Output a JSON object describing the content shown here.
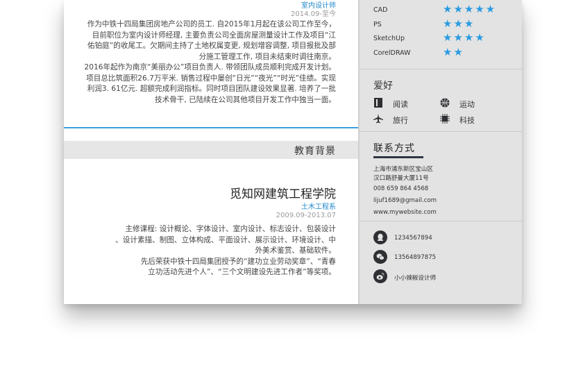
{
  "work": {
    "role": "室内设计师",
    "date": "2014.09-至今",
    "para1": "作为中铁十四局集团房地产公司的员工. 自2015年1月起在该公司工作至今，\n目前职位为室内设计师经理, 主要负责公司全面房屋测量设计工作及项目“江\n佑铂庭”的收尾工。欠期间主持了土地权属变更, 规划增容调整, 项目报批及部\n分施工管理工作, 项目未结束时调往南京。",
    "para2": "2016年起作为南京“美丽办公”项目负责人. 带领团队成员顺利完成开发计划。\n项目总比筑面积26.7万平米. 销售过程中屡创“日光”“夜光”“时光”佳绩。实现\n利润3. 61亿元. 超额完成利润指标。同时项目团队建设效果显著. 培养了一批\n技术骨干, 已陆续在公司其他项目开发工作中独当一面。"
  },
  "education": {
    "section_title": "教育背景",
    "school": "觅知网建筑工程学院",
    "major": "土木工程系",
    "date": "2009.09-2013.07",
    "para": "主修课程: 设计概论、字体设计、室内设计、标志设计、包装设计\n、设计素描、制图、立体构成、平面设计、展示设计、环境设计、中\n外美术鉴赏、基础软件。\n先后荣获中铁十四局集团授予的“建功立业劳动奖章”、“青春\n立功活动先进个人”、“三个文明建设先进工作者”等奖项。"
  },
  "skills": [
    {
      "name": "CAD",
      "stars": "★★★★★"
    },
    {
      "name": "PS",
      "stars": "★★★"
    },
    {
      "name": "SketchUp",
      "stars": "★★★★"
    },
    {
      "name": "CorelDRAW",
      "stars": "★★"
    }
  ],
  "hobbies": {
    "title": "爱好",
    "items": [
      {
        "label": "阅读",
        "icon": "book-icon"
      },
      {
        "label": "运动",
        "icon": "basketball-icon"
      },
      {
        "label": "旅行",
        "icon": "airplane-icon"
      },
      {
        "label": "科技",
        "icon": "chip-icon"
      }
    ]
  },
  "contact": {
    "title": "联系方式",
    "address1": "上海市浦东新区宝山区",
    "address2": "汉口路舒曼大厦11号",
    "phone": "008 659 864 4568",
    "email": "lijuf1689@gmail.com",
    "website": "www.mywebsite.com",
    "qq": "1234567894",
    "wechat": "13564897875",
    "weibo": "小小辣椒设计师"
  },
  "colors": {
    "accent": "#1e88c9",
    "stars": "#2a9be0",
    "sidebar": "#e3e3e3"
  }
}
